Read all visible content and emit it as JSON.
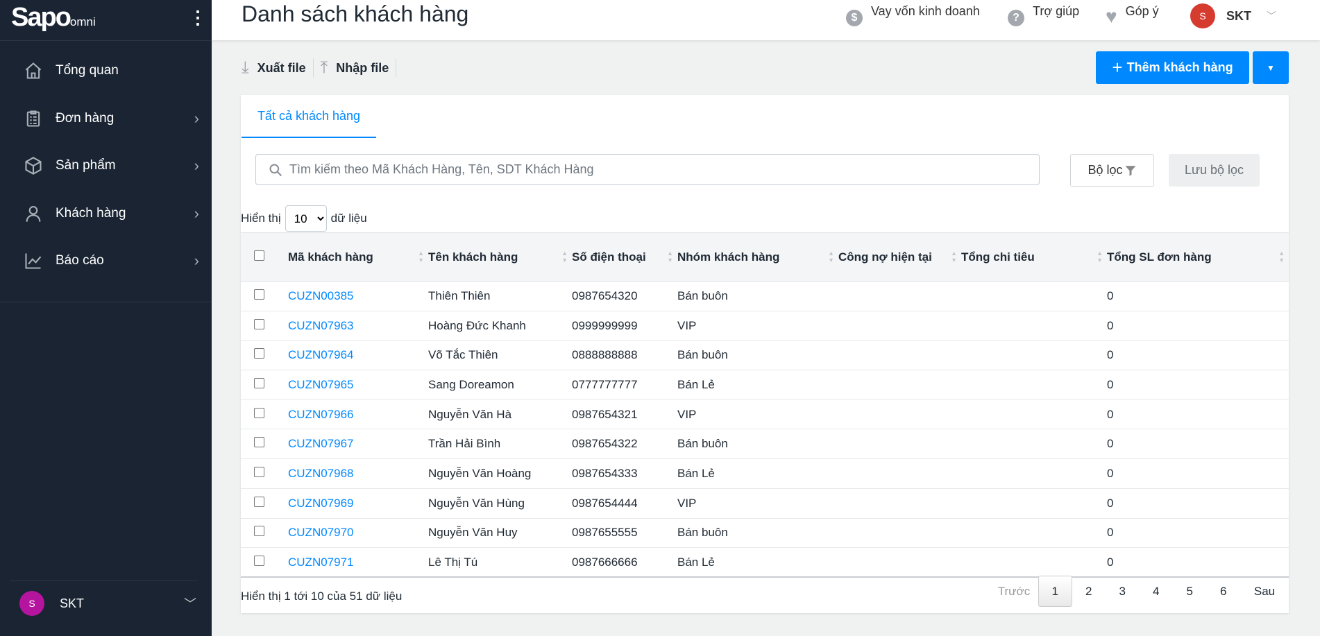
{
  "sidebar": {
    "logo": "Sapo",
    "logo_sub": "omni",
    "items": [
      {
        "label": "Tổng quan",
        "icon": "home-icon"
      },
      {
        "label": "Đơn hàng",
        "icon": "clipboard-icon"
      },
      {
        "label": "Sản phẩm",
        "icon": "box-icon"
      },
      {
        "label": "Khách hàng",
        "icon": "user-icon"
      },
      {
        "label": "Báo cáo",
        "icon": "chart-icon"
      }
    ],
    "user": {
      "initial": "S",
      "name": "SKT",
      "color": "#b5159e"
    }
  },
  "header": {
    "title": "Danh sách khách hàng",
    "loan": "Vay vốn kinh doanh",
    "help": "Trợ giúp",
    "feedback": "Góp ý",
    "user_initial": "S",
    "user_name": "SKT",
    "avatar_color": "#d63b2f"
  },
  "toolbar": {
    "export": "Xuất file",
    "import": "Nhập file",
    "add": "Thêm khách hàng"
  },
  "tab": "Tất cả khách hàng",
  "search": {
    "placeholder": "Tìm kiếm theo Mã Khách Hàng, Tên, SDT Khách Hàng",
    "value": ""
  },
  "filter": "Bộ lọc",
  "save_filter": "Lưu bộ lọc",
  "show": {
    "prefix": "Hiển thị",
    "value": "10",
    "suffix": "dữ liệu"
  },
  "columns": [
    "Mã khách hàng",
    "Tên khách hàng",
    "Số điện thoại",
    "Nhóm khách hàng",
    "Công nợ hiện tại",
    "Tổng chi tiêu",
    "Tổng SL đơn hàng"
  ],
  "rows": [
    [
      "CUZN00385",
      "Thiên Thiên",
      "0987654320",
      "Bán buôn",
      "",
      "",
      "0"
    ],
    [
      "CUZN07963",
      "Hoàng Đức Khanh",
      "0999999999",
      "VIP",
      "",
      "",
      "0"
    ],
    [
      "CUZN07964",
      "Võ Tắc Thiên",
      "0888888888",
      "Bán buôn",
      "",
      "",
      "0"
    ],
    [
      "CUZN07965",
      "Sang Doreamon",
      "0777777777",
      "Bán Lẻ",
      "",
      "",
      "0"
    ],
    [
      "CUZN07966",
      "Nguyễn Văn Hà",
      "0987654321",
      "VIP",
      "",
      "",
      "0"
    ],
    [
      "CUZN07967",
      "Trần Hải Bình",
      "0987654322",
      "Bán buôn",
      "",
      "",
      "0"
    ],
    [
      "CUZN07968",
      "Nguyễn Văn Hoàng",
      "0987654333",
      "Bán Lẻ",
      "",
      "",
      "0"
    ],
    [
      "CUZN07969",
      "Nguyễn Văn Hùng",
      "0987654444",
      "VIP",
      "",
      "",
      "0"
    ],
    [
      "CUZN07970",
      "Nguyễn Văn Huy",
      "0987655555",
      "Bán buôn",
      "",
      "",
      "0"
    ],
    [
      "CUZN07971",
      "Lê Thị Tú",
      "0987666666",
      "Bán Lẻ",
      "",
      "",
      "0"
    ]
  ],
  "footer": "Hiển thị 1 tới 10 của 51 dữ liệu",
  "pagination": {
    "prev": "Trước",
    "pages": [
      "1",
      "2",
      "3",
      "4",
      "5",
      "6"
    ],
    "current": "1",
    "next": "Sau"
  }
}
